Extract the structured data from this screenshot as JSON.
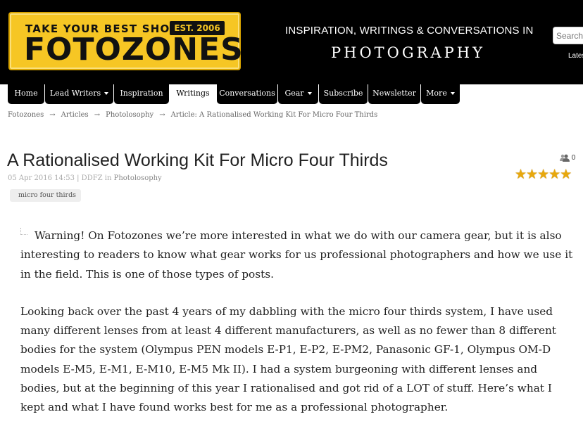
{
  "header": {
    "logo": {
      "tagline": "TAKE YOUR BEST SHOT",
      "est": "EST. 2006",
      "name": "FOTOZONES"
    },
    "tagline_line1": "INSPIRATION, WRITINGS & CONVERSATIONS IN",
    "tagline_line2": "PHOTOGRAPHY",
    "search_placeholder": "Search",
    "latest_label": "Lates"
  },
  "nav": {
    "items": [
      {
        "label": "Home",
        "dropdown": false
      },
      {
        "label": "Lead Writers",
        "dropdown": true
      },
      {
        "label": "Inspiration",
        "dropdown": false
      },
      {
        "label": "Writings",
        "dropdown": false,
        "active": true
      },
      {
        "label": "Conversations",
        "dropdown": false
      },
      {
        "label": "Gear",
        "dropdown": true
      },
      {
        "label": "Subscribe",
        "dropdown": false
      },
      {
        "label": "Newsletter",
        "dropdown": false
      },
      {
        "label": "More",
        "dropdown": true
      }
    ]
  },
  "breadcrumb": {
    "items": [
      "Fotozones",
      "Articles",
      "Photolosophy",
      "Article: A Rationalised Working Kit For Micro Four Thirds"
    ],
    "separator": "→"
  },
  "article": {
    "title": "A Rationalised Working Kit For Micro Four Thirds",
    "date": "05 Apr 2016 14:53",
    "author": "DDFZ",
    "in_label": "in",
    "category": "Photolosophy",
    "views_count": "0",
    "rating_stars": 5,
    "tag": "micro four thirds",
    "paragraph1": "Warning! On Fotozones we’re more interested in what we do with our camera gear, but it is also interesting to readers to know what gear works for us professional photographers and how we use it in the field. This is one of those types of posts.",
    "paragraph2": "Looking back over the past 4 years of my dabbling with the micro four thirds system, I have used many different lenses from at least 4 different manufacturers, as well as no fewer than 8 different bodies for the system (Olympus PEN models E-P1, E-P2, E-PM2, Panasonic GF-1, Olympus OM-D models E-M5, E-M1, E-M10, E-M5 Mk II). I had a system burgeoning with different lenses and bodies, but at the beginning of this year I rationalised and got rid of a LOT of stuff. Here’s what I kept and what I have found works best for me as a professional photographer."
  },
  "colors": {
    "header_bg": "#000000",
    "logo_yellow": "#f6c624",
    "star_gold": "#e8a80c"
  }
}
